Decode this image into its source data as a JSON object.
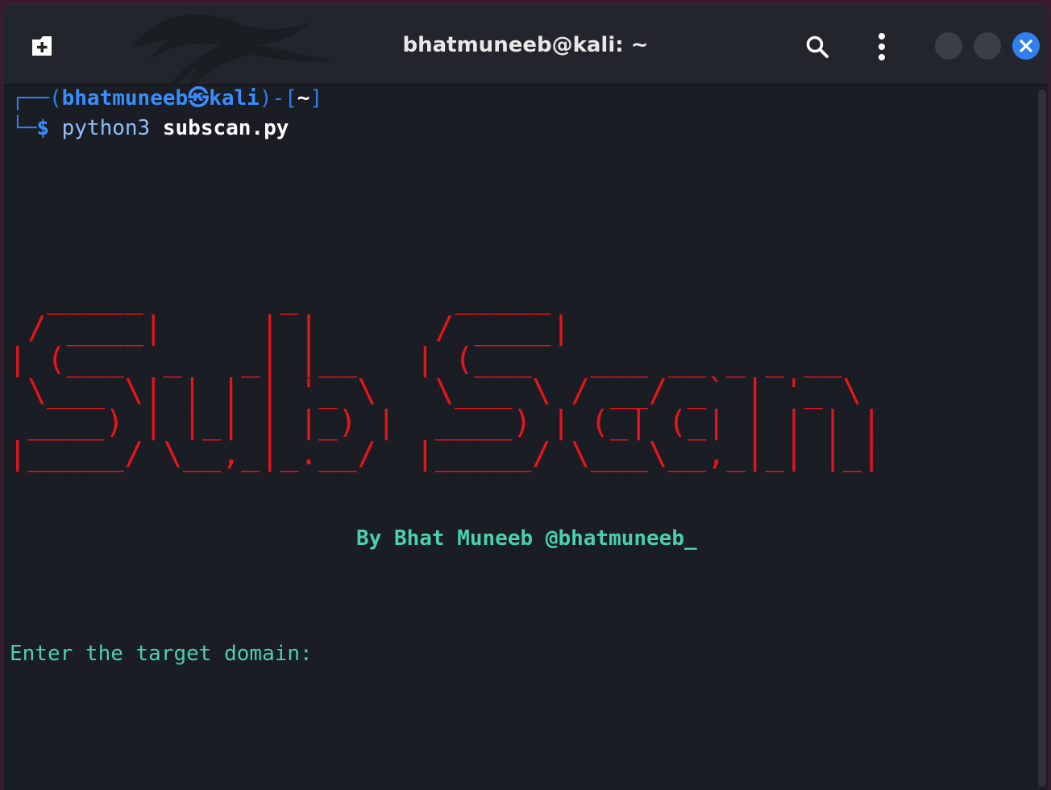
{
  "window": {
    "title": "bhatmuneeb@kali: ~"
  },
  "icons": {
    "new_tab": "new-tab-icon",
    "search": "search-icon",
    "menu": "kebab-menu-icon",
    "close": "close-icon"
  },
  "colors": {
    "accent": "#2f7ff0",
    "banner": "#e8141c",
    "credit": "#4ad0b0",
    "background": "#1a1d23"
  },
  "terminal": {
    "prompt": {
      "open": "┌──(",
      "user": "bhatmuneeb",
      "at_symbol": "㉿",
      "host": "kali",
      "close_mid": ")-[",
      "path": "~",
      "close": "]",
      "corner": "└─",
      "dollar": "$",
      "command": "python3",
      "argument": "subscan.py"
    },
    "banner": "  _____       _        _____\n / ____|     | |      / ____|\n| (___  _   _| |__   | (___   ___ __ _ _ __\n \\___ \\| | | | '_ \\   \\___ \\ / __/ _` | '_ \\\n ____) | |_| | |_) |  ____) | (_| (_| | | | |\n|_____/ \\__,_|_.__/  |_____/ \\___\\__,_|_| |_|",
    "credit": "By Bhat Muneeb @bhatmuneeb_",
    "input_prompt": "Enter the target domain:"
  }
}
